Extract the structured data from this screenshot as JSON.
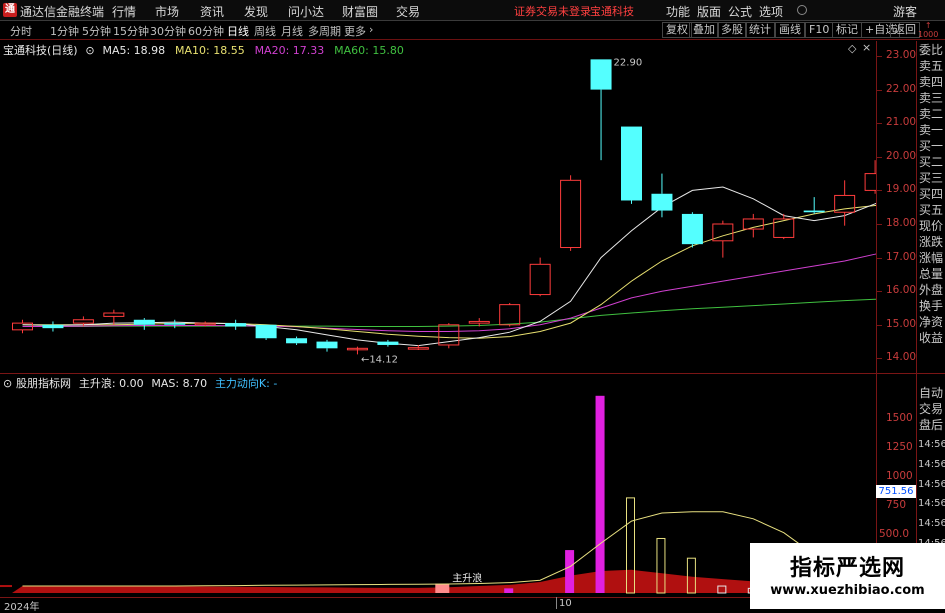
{
  "titlebar": {
    "app_title": "通达信金融终端",
    "menus": [
      "行情",
      "市场",
      "资讯",
      "发现",
      "问小达",
      "财富圈",
      "交易"
    ],
    "status": "证券交易未登录",
    "stock_name": "宝通科技",
    "right_menus": [
      "功能",
      "版面",
      "公式",
      "选项"
    ],
    "user": "游客"
  },
  "toolbar": {
    "periods": [
      "分时",
      "1分钟",
      "5分钟",
      "15分钟",
      "30分钟",
      "60分钟",
      "日线",
      "周线",
      "月线",
      "多周期",
      "更多"
    ],
    "selected_period": "日线",
    "right_buttons": [
      "复权",
      "叠加",
      "多股",
      "统计",
      "画线",
      "F10",
      "标记",
      "+自选",
      "返回"
    ]
  },
  "main_chart": {
    "title": "宝通科技(日线)",
    "legend": [
      {
        "label": "MA5: 18.98",
        "color": "#e8e8e8"
      },
      {
        "label": "MA10: 18.55",
        "color": "#e8e070"
      },
      {
        "label": "MA20: 17.33",
        "color": "#d040d0"
      },
      {
        "label": "MA60: 15.80",
        "color": "#40c040"
      }
    ],
    "high_label": "22.90",
    "low_label": "14.12",
    "y_ticks": [
      "23.00",
      "22.00",
      "21.00",
      "20.00",
      "19.00",
      "18.00",
      "17.00",
      "16.00",
      "15.00",
      "14.00"
    ]
  },
  "sub_chart": {
    "title": "股朋指标网",
    "legend": [
      {
        "label": "主升浪: 0.00",
        "color": "#e8e8e8"
      },
      {
        "label": "MAS: 8.70",
        "color": "#e8e8e8"
      },
      {
        "label": "主力动向K: -",
        "color": "#40c0ff"
      }
    ],
    "annotation": "主升浪",
    "y_ticks": [
      "1500",
      "1250",
      "1000",
      "750",
      "500.0"
    ],
    "current_value": "751.56"
  },
  "side_panel": {
    "top_labels": [
      "委比",
      "卖五",
      "卖四",
      "卖三",
      "卖二",
      "卖一",
      "买一",
      "买二",
      "买三",
      "买四",
      "买五",
      "现价",
      "涨跌",
      "涨幅",
      "总量",
      "外盘",
      "换手",
      "净资",
      "收益"
    ],
    "bottom_labels": [
      "自动",
      "交易",
      "盘后"
    ],
    "times": [
      "14:56",
      "14:56",
      "14:56",
      "14:56",
      "14:56",
      "14:56",
      "14:56"
    ]
  },
  "x_axis": {
    "labels": [
      "2024年",
      "10"
    ]
  },
  "watermark": {
    "title": "指标严选网",
    "url": "www.xuezhibiao.com"
  },
  "chart_data": {
    "type": "candlestick",
    "ylim": [
      13.6,
      23.4
    ],
    "candles": [
      {
        "o": 14.85,
        "c": 15.05,
        "h": 15.15,
        "l": 14.75
      },
      {
        "o": 15.0,
        "c": 14.9,
        "h": 15.1,
        "l": 14.8
      },
      {
        "o": 15.05,
        "c": 15.15,
        "h": 15.25,
        "l": 14.95
      },
      {
        "o": 15.25,
        "c": 15.35,
        "h": 15.45,
        "l": 15.0
      },
      {
        "o": 15.15,
        "c": 15.0,
        "h": 15.2,
        "l": 14.85
      },
      {
        "o": 15.05,
        "c": 15.0,
        "h": 15.15,
        "l": 14.9
      },
      {
        "o": 15.0,
        "c": 15.05,
        "h": 15.1,
        "l": 14.95
      },
      {
        "o": 15.05,
        "c": 14.95,
        "h": 15.15,
        "l": 14.85
      },
      {
        "o": 15.0,
        "c": 14.6,
        "h": 15.0,
        "l": 14.55
      },
      {
        "o": 14.6,
        "c": 14.45,
        "h": 14.65,
        "l": 14.4
      },
      {
        "o": 14.5,
        "c": 14.3,
        "h": 14.55,
        "l": 14.2
      },
      {
        "o": 14.3,
        "c": 14.3,
        "h": 14.35,
        "l": 14.12
      },
      {
        "o": 14.5,
        "c": 14.4,
        "h": 14.55,
        "l": 14.35
      },
      {
        "o": 14.3,
        "c": 14.32,
        "h": 14.4,
        "l": 14.25
      },
      {
        "o": 14.4,
        "c": 15.0,
        "h": 15.05,
        "l": 14.3
      },
      {
        "o": 15.05,
        "c": 15.1,
        "h": 15.2,
        "l": 14.95
      },
      {
        "o": 15.0,
        "c": 15.6,
        "h": 15.65,
        "l": 14.95
      },
      {
        "o": 15.9,
        "c": 16.8,
        "h": 17.0,
        "l": 15.85
      },
      {
        "o": 17.3,
        "c": 19.3,
        "h": 19.45,
        "l": 17.2
      },
      {
        "o": 22.9,
        "c": 22.0,
        "h": 22.9,
        "l": 19.9
      },
      {
        "o": 20.9,
        "c": 18.7,
        "h": 20.9,
        "l": 18.6
      },
      {
        "o": 18.9,
        "c": 18.4,
        "h": 19.5,
        "l": 18.2
      },
      {
        "o": 18.3,
        "c": 17.4,
        "h": 18.35,
        "l": 17.3
      },
      {
        "o": 17.5,
        "c": 18.0,
        "h": 18.1,
        "l": 17.0
      },
      {
        "o": 17.85,
        "c": 18.15,
        "h": 18.3,
        "l": 17.6
      },
      {
        "o": 17.6,
        "c": 18.15,
        "h": 18.3,
        "l": 17.55
      },
      {
        "o": 18.4,
        "c": 18.35,
        "h": 18.8,
        "l": 18.3
      },
      {
        "o": 18.35,
        "c": 18.85,
        "h": 19.3,
        "l": 17.95
      },
      {
        "o": 19.0,
        "c": 19.5,
        "h": 19.9,
        "l": 18.9
      },
      {
        "o": 19.5,
        "c": 20.0,
        "h": 21.0,
        "l": 19.45
      }
    ],
    "ma5": [
      15.0,
      14.98,
      15.0,
      15.05,
      15.06,
      15.08,
      15.05,
      15.03,
      14.95,
      14.85,
      14.7,
      14.55,
      14.45,
      14.38,
      14.5,
      14.62,
      14.78,
      15.1,
      15.7,
      17.0,
      17.8,
      18.5,
      19.0,
      19.1,
      18.75,
      18.25,
      18.1,
      18.25,
      18.6,
      18.98
    ],
    "ma10": [
      15.0,
      15.0,
      15.0,
      15.0,
      15.02,
      15.04,
      15.05,
      15.04,
      15.0,
      14.95,
      14.88,
      14.8,
      14.72,
      14.66,
      14.62,
      14.6,
      14.65,
      14.8,
      15.05,
      15.6,
      16.3,
      16.9,
      17.35,
      17.65,
      17.9,
      18.1,
      18.3,
      18.45,
      18.55,
      18.55
    ],
    "ma20": [
      14.95,
      14.95,
      14.96,
      14.97,
      14.98,
      14.98,
      14.98,
      14.97,
      14.96,
      14.94,
      14.9,
      14.86,
      14.82,
      14.8,
      14.8,
      14.82,
      14.88,
      15.0,
      15.2,
      15.5,
      15.8,
      16.0,
      16.15,
      16.3,
      16.45,
      16.6,
      16.75,
      16.9,
      17.1,
      17.33
    ],
    "ma60": [
      14.95,
      14.95,
      14.95,
      14.96,
      14.96,
      14.96,
      14.96,
      14.96,
      14.96,
      14.96,
      14.96,
      14.95,
      14.95,
      14.95,
      14.96,
      14.98,
      15.02,
      15.08,
      15.18,
      15.28,
      15.35,
      15.42,
      15.48,
      15.52,
      15.57,
      15.62,
      15.67,
      15.72,
      15.76,
      15.8
    ],
    "sub_ylim": [
      0,
      1800
    ],
    "sub_bars": [
      {
        "i": 18,
        "v": 370,
        "color": "#e020e0",
        "style": "fill"
      },
      {
        "i": 19,
        "v": 1700,
        "color": "#e020e0",
        "style": "fill"
      },
      {
        "i": 20,
        "v": 820,
        "color": "#e8e080",
        "style": "hollow"
      },
      {
        "i": 21,
        "v": 470,
        "color": "#e8e080",
        "style": "hollow"
      },
      {
        "i": 22,
        "v": 300,
        "color": "#e8e080",
        "style": "hollow"
      },
      {
        "i": 23,
        "v": 60,
        "color": "#e8e8e8",
        "style": "hollow"
      },
      {
        "i": 24,
        "v": 40,
        "color": "#e8e8e8",
        "style": "hollow"
      },
      {
        "i": 25,
        "v": 30,
        "color": "#e8e8e8",
        "style": "hollow"
      },
      {
        "i": 26,
        "v": 20,
        "color": "#e8e8e8",
        "style": "hollow"
      },
      {
        "i": 27,
        "v": 10,
        "color": "#e8e8e8",
        "style": "hollow"
      }
    ],
    "sub_line": [
      60,
      60,
      60,
      60,
      60,
      60,
      62,
      64,
      66,
      68,
      70,
      72,
      74,
      76,
      78,
      82,
      90,
      110,
      230,
      430,
      620,
      690,
      700,
      700,
      640,
      520,
      330,
      170,
      80,
      40
    ],
    "sub_area": [
      60,
      60,
      60,
      60,
      60,
      58,
      56,
      54,
      52,
      50,
      48,
      46,
      44,
      44,
      50,
      60,
      70,
      95,
      150,
      190,
      200,
      170,
      140,
      120,
      100,
      80,
      70,
      60,
      50,
      40
    ]
  }
}
